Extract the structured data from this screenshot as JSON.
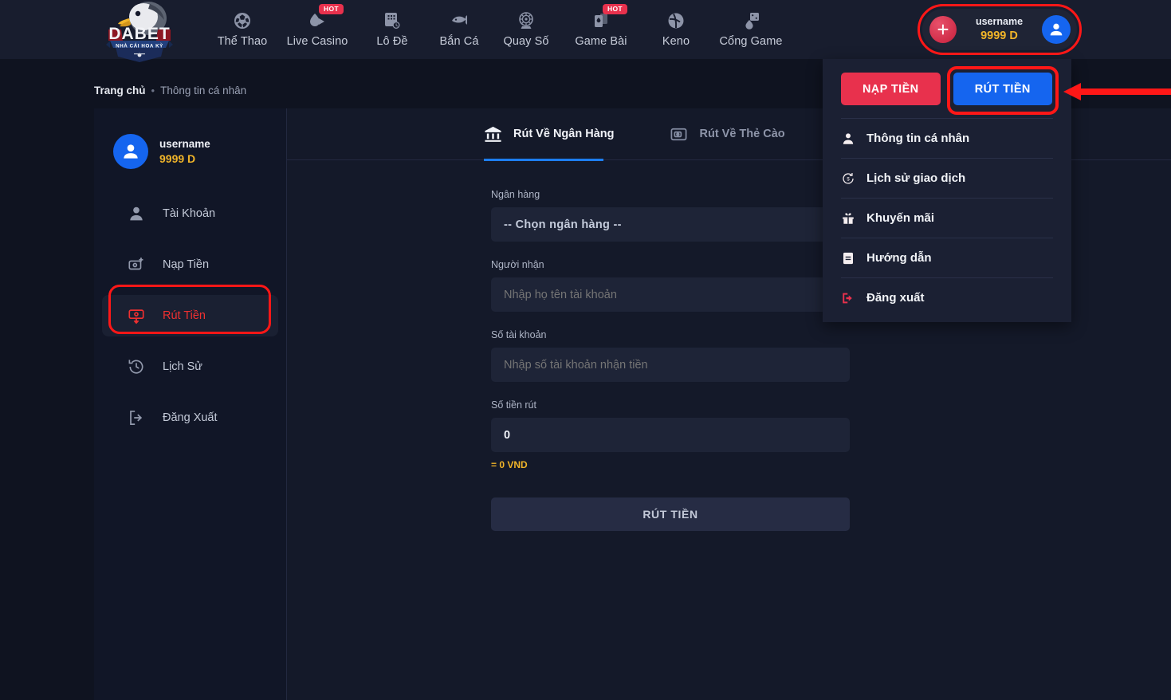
{
  "brand": {
    "logo_text": "DABET",
    "logo_tagline": "NHÀ CÁI HOA KỲ"
  },
  "header": {
    "nav": [
      {
        "label": "Thể Thao",
        "icon": "soccer-ball-icon",
        "badge": ""
      },
      {
        "label": "Live Casino",
        "icon": "live-casino-icon",
        "badge": "HOT"
      },
      {
        "label": "Lô Đề",
        "icon": "lottery-ticket-icon",
        "badge": ""
      },
      {
        "label": "Bắn Cá",
        "icon": "fish-shooting-icon",
        "badge": ""
      },
      {
        "label": "Quay Số",
        "icon": "spin-wheel-icon",
        "badge": ""
      },
      {
        "label": "Game Bài",
        "icon": "playing-cards-icon",
        "badge": "HOT"
      },
      {
        "label": "Keno",
        "icon": "keno-ball-icon",
        "badge": ""
      },
      {
        "label": "Cổng Game",
        "icon": "game-portal-icon",
        "badge": ""
      }
    ],
    "user": {
      "name": "username",
      "balance": "9999 D",
      "plus_icon": "plus-icon",
      "avatar_icon": "user-avatar-icon"
    }
  },
  "dropdown": {
    "deposit_label": "NẠP TIỀN",
    "withdraw_label": "RÚT TIỀN",
    "items": [
      {
        "label": "Thông tin cá nhân",
        "icon": "person-icon"
      },
      {
        "label": "Lịch sử giao dịch",
        "icon": "transaction-history-icon"
      },
      {
        "label": "Khuyến mãi",
        "icon": "gift-icon"
      },
      {
        "label": "Hướng dẫn",
        "icon": "document-icon"
      },
      {
        "label": "Đăng xuất",
        "icon": "logout-icon"
      }
    ]
  },
  "breadcrumb": {
    "home": "Trang chủ",
    "separator": "•",
    "current": "Thông tin cá nhân"
  },
  "sidebar": {
    "user": {
      "name": "username",
      "balance": "9999 D",
      "avatar_icon": "user-avatar-icon"
    },
    "items": [
      {
        "label": "Tài Khoản",
        "icon": "person-icon",
        "active": false
      },
      {
        "label": "Nạp Tiền",
        "icon": "deposit-money-icon",
        "active": false
      },
      {
        "label": "Rút Tiền",
        "icon": "withdraw-money-icon",
        "active": true
      },
      {
        "label": "Lịch Sử",
        "icon": "history-clock-icon",
        "active": false
      },
      {
        "label": "Đăng Xuất",
        "icon": "logout-icon",
        "active": false
      }
    ]
  },
  "main": {
    "tabs": [
      {
        "label": "Rút Về Ngân Hàng",
        "icon": "bank-icon",
        "active": true
      },
      {
        "label": "Rút Về Thẻ Cào",
        "icon": "prepaid-card-icon",
        "active": false
      },
      {
        "label": "",
        "icon": "bitcoin-coin-icon",
        "active": false
      }
    ],
    "form": {
      "bank": {
        "label": "Ngân hàng",
        "value": "-- Chọn ngân hàng --"
      },
      "recipient": {
        "label": "Người nhận",
        "placeholder": "Nhập họ tên tài khoản",
        "value": ""
      },
      "account_number": {
        "label": "Số tài khoản",
        "placeholder": "Nhập số tài khoản nhận tiền",
        "value": ""
      },
      "amount": {
        "label": "Số tiền rút",
        "value": "0",
        "note": "= 0 VND"
      },
      "submit_label": "RÚT TIỀN"
    }
  },
  "annotations": {
    "highlight_color": "#ff1717",
    "arrow": "left-arrow-annotation"
  },
  "colors": {
    "page_bg": "#0f1320",
    "header_bg": "#181d2e",
    "card_bg": "#141929",
    "sidebar_bg": "#111627",
    "accent_red": "#e8314d",
    "accent_blue": "#1565ef",
    "gold": "#f0b429",
    "tab_underline": "#1d7ef0"
  }
}
